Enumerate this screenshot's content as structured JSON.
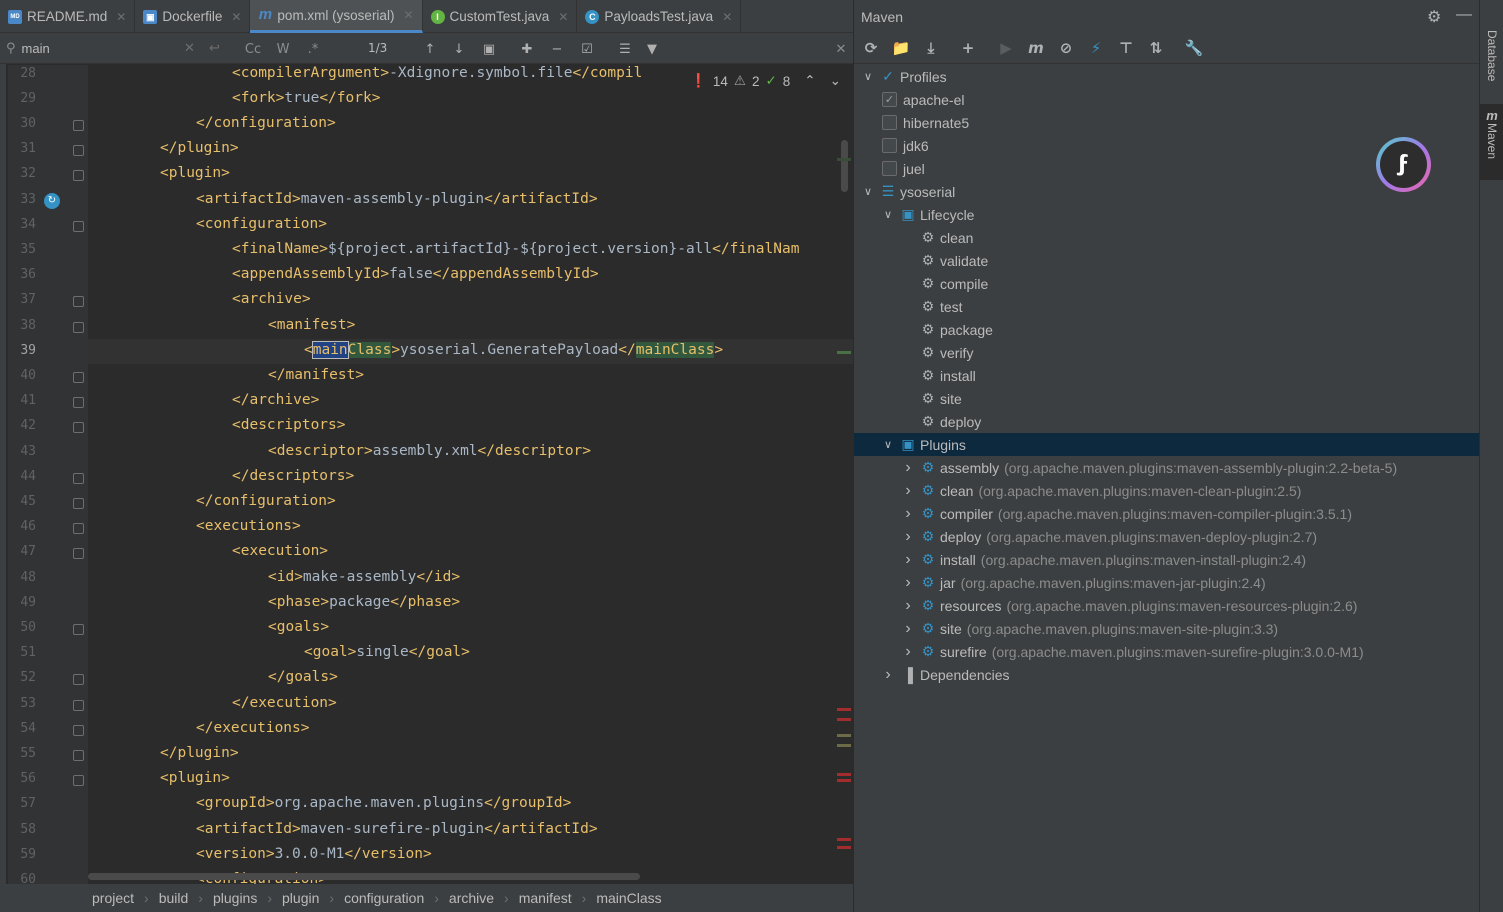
{
  "tabs": [
    {
      "label": "README.md",
      "icon": "markdown-icon",
      "color": "#4a88c7",
      "active": false
    },
    {
      "label": "Dockerfile",
      "icon": "docker-icon",
      "color": "#4a88c7",
      "active": false
    },
    {
      "label": "pom.xml (ysoserial)",
      "icon": "maven-icon",
      "color": "#4a88c7",
      "active": true
    },
    {
      "label": "CustomTest.java",
      "icon": "interface-icon",
      "color": "#62b543",
      "active": false
    },
    {
      "label": "PayloadsTest.java",
      "icon": "class-icon",
      "color": "#3592c4",
      "active": false
    }
  ],
  "find": {
    "query": "main",
    "match_counter": "1/3",
    "cc_label": "Cc",
    "w_label": "W",
    "regex_label": ".*"
  },
  "inspections": {
    "errors": "14",
    "warnings": "2",
    "ok": "8"
  },
  "code_lines": [
    {
      "n": "28",
      "indent": 5,
      "html": "<span class='t'>&lt;compilerArgument&gt;</span>-Xdignore.symbol.file<span class='t'>&lt;/compil</span>"
    },
    {
      "n": "29",
      "indent": 5,
      "html": "<span class='t'>&lt;fork&gt;</span>true<span class='t'>&lt;/fork&gt;</span>"
    },
    {
      "n": "30",
      "indent": 4,
      "html": "<span class='t'>&lt;/configuration&gt;</span>"
    },
    {
      "n": "31",
      "indent": 3,
      "html": "<span class='t'>&lt;/plugin&gt;</span>"
    },
    {
      "n": "32",
      "indent": 3,
      "html": "<span class='t'>&lt;plugin&gt;</span>"
    },
    {
      "n": "33",
      "indent": 4,
      "html": "<span class='t'>&lt;artifactId&gt;</span>maven-assembly-plugin<span class='t'>&lt;/artifactId&gt;</span>"
    },
    {
      "n": "34",
      "indent": 4,
      "html": "<span class='t'>&lt;configuration&gt;</span>"
    },
    {
      "n": "35",
      "indent": 5,
      "html": "<span class='t'>&lt;finalName&gt;</span>${project.artifactId}-${project.version}-all<span class='t'>&lt;/finalNam</span>"
    },
    {
      "n": "36",
      "indent": 5,
      "html": "<span class='t'>&lt;appendAssemblyId&gt;</span>false<span class='t'>&lt;/appendAssemblyId&gt;</span>"
    },
    {
      "n": "37",
      "indent": 5,
      "html": "<span class='t'>&lt;archive&gt;</span>"
    },
    {
      "n": "38",
      "indent": 6,
      "html": "<span class='t'>&lt;manifest&gt;</span>"
    },
    {
      "n": "39",
      "indent": 7,
      "html": "<span class='t'>&lt;<span style='background:#214283;outline:1px solid #bbbbbb'>main</span><span style='background:#32593d'>Class</span>&gt;</span>ysoserial.GeneratePayload<span class='t'>&lt;/<span style='background:#32593d'>mainClass</span>&gt;</span>"
    },
    {
      "n": "40",
      "indent": 6,
      "html": "<span class='t'>&lt;/manifest&gt;</span>"
    },
    {
      "n": "41",
      "indent": 5,
      "html": "<span class='t'>&lt;/archive&gt;</span>"
    },
    {
      "n": "42",
      "indent": 5,
      "html": "<span class='t'>&lt;descriptors&gt;</span>"
    },
    {
      "n": "43",
      "indent": 6,
      "html": "<span class='t'>&lt;descriptor&gt;</span>assembly.xml<span class='t'>&lt;/descriptor&gt;</span>"
    },
    {
      "n": "44",
      "indent": 5,
      "html": "<span class='t'>&lt;/descriptors&gt;</span>"
    },
    {
      "n": "45",
      "indent": 4,
      "html": "<span class='t'>&lt;/configuration&gt;</span>"
    },
    {
      "n": "46",
      "indent": 4,
      "html": "<span class='t'>&lt;executions&gt;</span>"
    },
    {
      "n": "47",
      "indent": 5,
      "html": "<span class='t'>&lt;execution&gt;</span>"
    },
    {
      "n": "48",
      "indent": 6,
      "html": "<span class='t'>&lt;id&gt;</span>make-assembly<span class='t'>&lt;/id&gt;</span>"
    },
    {
      "n": "49",
      "indent": 6,
      "html": "<span class='t'>&lt;phase&gt;</span>package<span class='t'>&lt;/phase&gt;</span>"
    },
    {
      "n": "50",
      "indent": 6,
      "html": "<span class='t'>&lt;goals&gt;</span>"
    },
    {
      "n": "51",
      "indent": 7,
      "html": "<span class='t'>&lt;goal&gt;</span>single<span class='t'>&lt;/goal&gt;</span>"
    },
    {
      "n": "52",
      "indent": 6,
      "html": "<span class='t'>&lt;/goals&gt;</span>"
    },
    {
      "n": "53",
      "indent": 5,
      "html": "<span class='t'>&lt;/execution&gt;</span>"
    },
    {
      "n": "54",
      "indent": 4,
      "html": "<span class='t'>&lt;/executions&gt;</span>"
    },
    {
      "n": "55",
      "indent": 3,
      "html": "<span class='t'>&lt;/plugin&gt;</span>"
    },
    {
      "n": "56",
      "indent": 3,
      "html": "<span class='t'>&lt;plugin&gt;</span>"
    },
    {
      "n": "57",
      "indent": 4,
      "html": "<span class='t'>&lt;groupId&gt;</span>org.apache.maven.plugins<span class='t'>&lt;/groupId&gt;</span>"
    },
    {
      "n": "58",
      "indent": 4,
      "html": "<span class='t'>&lt;artifactId&gt;</span>maven-surefire-plugin<span class='t'>&lt;/artifactId&gt;</span>"
    },
    {
      "n": "59",
      "indent": 4,
      "html": "<span class='t'>&lt;version&gt;</span>3.0.0-M1<span class='t'>&lt;/version&gt;</span>"
    },
    {
      "n": "60",
      "indent": 4,
      "html": "<span class='t'>&lt;configuration&gt;</span>"
    }
  ],
  "current_line": "39",
  "breadcrumb": [
    "project",
    "build",
    "plugins",
    "plugin",
    "configuration",
    "archive",
    "manifest",
    "mainClass"
  ],
  "maven": {
    "title": "Maven",
    "profiles_label": "Profiles",
    "profiles": [
      {
        "label": "apache-el",
        "checked": true
      },
      {
        "label": "hibernate5",
        "checked": false
      },
      {
        "label": "jdk6",
        "checked": false
      },
      {
        "label": "juel",
        "checked": false
      }
    ],
    "project_label": "ysoserial",
    "lifecycle_label": "Lifecycle",
    "lifecycle": [
      "clean",
      "validate",
      "compile",
      "test",
      "package",
      "verify",
      "install",
      "site",
      "deploy"
    ],
    "plugins_label": "Plugins",
    "plugins": [
      {
        "name": "assembly",
        "coord": "(org.apache.maven.plugins:maven-assembly-plugin:2.2-beta-5)"
      },
      {
        "name": "clean",
        "coord": "(org.apache.maven.plugins:maven-clean-plugin:2.5)"
      },
      {
        "name": "compiler",
        "coord": "(org.apache.maven.plugins:maven-compiler-plugin:3.5.1)"
      },
      {
        "name": "deploy",
        "coord": "(org.apache.maven.plugins:maven-deploy-plugin:2.7)"
      },
      {
        "name": "install",
        "coord": "(org.apache.maven.plugins:maven-install-plugin:2.4)"
      },
      {
        "name": "jar",
        "coord": "(org.apache.maven.plugins:maven-jar-plugin:2.4)"
      },
      {
        "name": "resources",
        "coord": "(org.apache.maven.plugins:maven-resources-plugin:2.6)"
      },
      {
        "name": "site",
        "coord": "(org.apache.maven.plugins:maven-site-plugin:3.3)"
      },
      {
        "name": "surefire",
        "coord": "(org.apache.maven.plugins:maven-surefire-plugin:3.0.0-M1)"
      }
    ],
    "dependencies_label": "Dependencies"
  },
  "side_tabs": [
    {
      "label": "Database"
    },
    {
      "label": "Maven"
    }
  ]
}
